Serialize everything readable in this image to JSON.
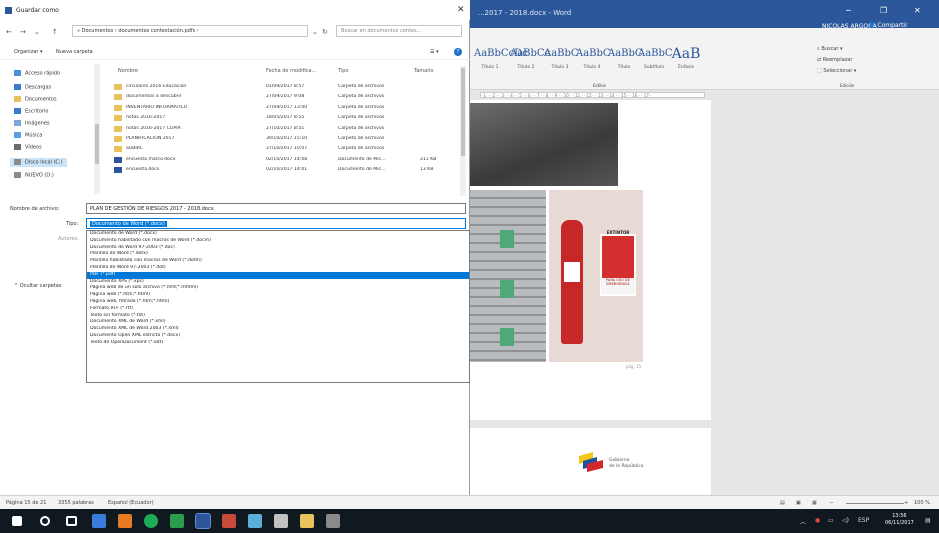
{
  "word": {
    "title": "...2017 - 2018.docx - Word",
    "user": "NICOLAS ARGONA",
    "share": "Compartir",
    "styles": [
      {
        "sample": "AaBbCcDc",
        "name": "Título 1"
      },
      {
        "sample": "AaBbCc",
        "name": "Título 2"
      },
      {
        "sample": "AaBbC",
        "name": "Título 3"
      },
      {
        "sample": "AaBbC",
        "name": "Título 4"
      },
      {
        "sample": "AaBbC",
        "name": "Título"
      },
      {
        "sample": "AaBbC",
        "name": "Subtítulo"
      },
      {
        "sample": "AaB",
        "name": "Énfasis"
      }
    ],
    "ribbon_right": {
      "find": "Buscar",
      "replace": "Reemplazar",
      "select": "Seleccionar",
      "group": "Edición",
      "styles_group": "Estilos"
    },
    "ruler": "· 1 · · 2 · · 3 · · 4 · · 5 · · 6 · · 7 · · 8 · · 9 · · 10 · · 11 · · 12 · · 13 · · 14 · · 15 · · 16 · · 17 ·",
    "sign_text": "EXTINTOR",
    "sign_sub": "PARA USO DE EMERGENCIA",
    "caption": "pág. 15",
    "logo_text": [
      "Gobierno",
      "de la República"
    ],
    "status": {
      "page": "Página 15 de 21",
      "words": "3355 palabras",
      "lang": "Español (Ecuador)"
    },
    "zoom": "100 %"
  },
  "dialog": {
    "title": "Guardar como",
    "address": "« Documentos › documentos contestación.pdfs ›",
    "search_placeholder": "Buscar en documentos contes...",
    "organize": "Organizar ▾",
    "new_folder": "Nueva carpeta",
    "nav_items": [
      {
        "label": "Acceso rápido",
        "color": "#4a90d9"
      },
      {
        "label": "Descargas",
        "color": "#3a7bd5"
      },
      {
        "label": "Documentos",
        "color": "#e9c35a"
      },
      {
        "label": "Escritorio",
        "color": "#3a7bd5"
      },
      {
        "label": "Imágenes",
        "color": "#7aa6d8"
      },
      {
        "label": "Música",
        "color": "#5aa0e0"
      },
      {
        "label": "Vídeos",
        "color": "#6a6a6a"
      },
      {
        "label": "Disco local (C:)",
        "color": "#8a8a8a"
      },
      {
        "label": "NUEVO (D:)",
        "color": "#8a8a8a"
      }
    ],
    "columns": {
      "name": "Nombre",
      "date": "Fecha de modifica...",
      "type": "Tipo",
      "size": "Tamaño"
    },
    "files": [
      {
        "name": "circulares 2016 Educación",
        "date": "01/09/2017 8:57",
        "type": "Carpeta de archivos",
        "size": "",
        "icon": "folder"
      },
      {
        "name": "documentos a descubrir",
        "date": "27/09/2017 9:08",
        "type": "Carpeta de archivos",
        "size": "",
        "icon": "folder"
      },
      {
        "name": "INVENTARIO INFORMÁTICO",
        "date": "27/09/2017 13:00",
        "type": "Carpeta de archivos",
        "size": "",
        "icon": "folder"
      },
      {
        "name": "notas 2016-2017",
        "date": "18/05/2017 8:55",
        "type": "Carpeta de archivos",
        "size": "",
        "icon": "folder"
      },
      {
        "name": "notas 2016-2017 COPIA",
        "date": "27/10/2017 8:51",
        "type": "Carpeta de archivos",
        "size": "",
        "icon": "folder"
      },
      {
        "name": "PLANIFICACIÓN 2017",
        "date": "30/10/2017 15:10",
        "type": "Carpeta de archivos",
        "size": "",
        "icon": "folder"
      },
      {
        "name": "SUBIRC",
        "date": "27/10/2017 10:07",
        "type": "Carpeta de archivos",
        "size": "",
        "icon": "folder"
      },
      {
        "name": "encuesta marco.docx",
        "date": "02/10/2017 14:08",
        "type": "Documento de Mic...",
        "size": "211 KB",
        "icon": "wdoc"
      },
      {
        "name": "encuesta.docx",
        "date": "02/10/2017 14:01",
        "type": "Documento de Mic...",
        "size": "13 KB",
        "icon": "wdoc"
      }
    ],
    "filename_label": "Nombre de archivo:",
    "filename_value": "PLAN DE GESTIÓN DE RIESGOS 2017 - 2018.docx",
    "type_label": "Tipo:",
    "type_value": "Documento de Word (*.docx)",
    "authors_label": "Autores:",
    "hide_folders": "Ocultar carpetas",
    "type_options": [
      {
        "label": "Documento de Word (*.docx)",
        "highlight": false
      },
      {
        "label": "Documento habilitado con macros de Word (*.docm)",
        "highlight": false
      },
      {
        "label": "Documento de Word 97-2003 (*.doc)",
        "highlight": false
      },
      {
        "label": "Plantilla de Word (*.dotx)",
        "highlight": false
      },
      {
        "label": "Plantilla habilitada con macros de Word (*.dotm)",
        "highlight": false
      },
      {
        "label": "Plantilla de Word 97-2003 (*.dot)",
        "highlight": false
      },
      {
        "label": "PDF (*.pdf)",
        "highlight": true
      },
      {
        "label": "Documento XPS (*.xps)",
        "highlight": false
      },
      {
        "label": "Página web de un solo archivo (*.mht;*.mhtml)",
        "highlight": false
      },
      {
        "label": "Página web (*.htm;*.html)",
        "highlight": false
      },
      {
        "label": "Página web, filtrada (*.htm;*.html)",
        "highlight": false
      },
      {
        "label": "Formato RTF (*.rtf)",
        "highlight": false
      },
      {
        "label": "Texto sin formato (*.txt)",
        "highlight": false
      },
      {
        "label": "Documento XML de Word (*.xml)",
        "highlight": false
      },
      {
        "label": "Documento XML de Word 2003 (*.xml)",
        "highlight": false
      },
      {
        "label": "Documento Open XML estricto (*.docx)",
        "highlight": false
      },
      {
        "label": "Texto de OpenDocument (*.odt)",
        "highlight": false
      }
    ]
  },
  "taskbar": {
    "time": "13:56",
    "date": "06/11/2017",
    "lang": "ESP"
  }
}
